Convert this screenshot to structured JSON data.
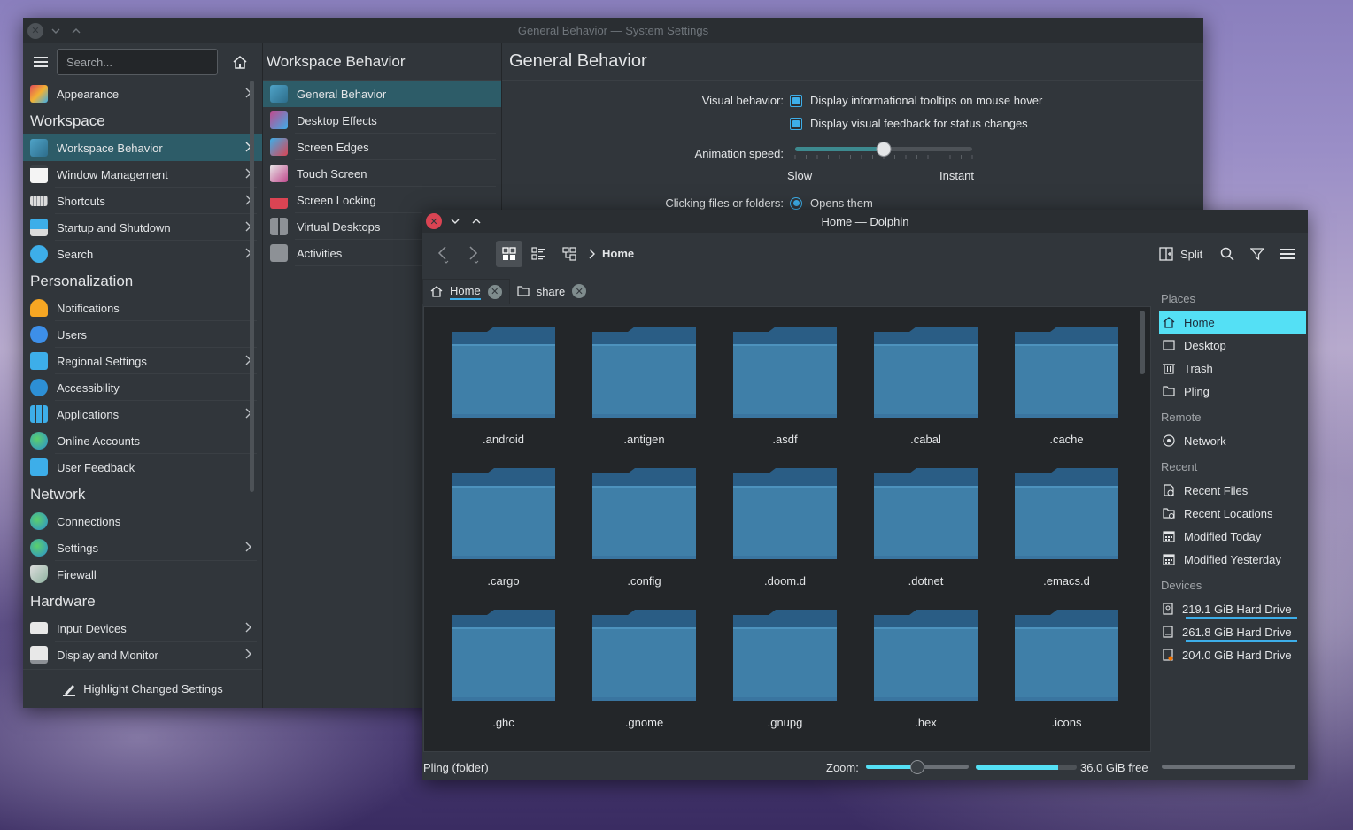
{
  "settings": {
    "window_title": "General Behavior — System Settings",
    "search_placeholder": "Search...",
    "sidebar": {
      "appearance": "Appearance",
      "cat_workspace": "Workspace",
      "workspace_behavior": "Workspace Behavior",
      "window_management": "Window Management",
      "shortcuts": "Shortcuts",
      "startup": "Startup and Shutdown",
      "search": "Search",
      "cat_personalization": "Personalization",
      "notifications": "Notifications",
      "users": "Users",
      "regional": "Regional Settings",
      "accessibility": "Accessibility",
      "applications": "Applications",
      "online_accounts": "Online Accounts",
      "user_feedback": "User Feedback",
      "cat_network": "Network",
      "connections": "Connections",
      "net_settings": "Settings",
      "firewall": "Firewall",
      "cat_hardware": "Hardware",
      "input_devices": "Input Devices",
      "display": "Display and Monitor"
    },
    "highlight_button": "Highlight Changed Settings",
    "middle": {
      "title": "Workspace Behavior",
      "items": [
        "General Behavior",
        "Desktop Effects",
        "Screen Edges",
        "Touch Screen",
        "Screen Locking",
        "Virtual Desktops",
        "Activities"
      ]
    },
    "page": {
      "title": "General Behavior",
      "visual_behavior_label": "Visual behavior:",
      "tooltips_label": "Display informational tooltips on mouse hover",
      "tooltips_checked": true,
      "feedback_label": "Display visual feedback for status changes",
      "feedback_checked": true,
      "animation_label": "Animation speed:",
      "animation_value": 0.5,
      "slow_label": "Slow",
      "instant_label": "Instant",
      "clicking_label": "Clicking files or folders:",
      "clicking_option": "Opens them"
    }
  },
  "dolphin": {
    "window_title": "Home — Dolphin",
    "breadcrumb": "Home",
    "split_label": "Split",
    "tabs": [
      {
        "label": "Home"
      },
      {
        "label": "share"
      }
    ],
    "files": [
      ".android",
      ".antigen",
      ".asdf",
      ".cabal",
      ".cache",
      ".cargo",
      ".config",
      ".doom.d",
      ".dotnet",
      ".emacs.d",
      ".ghc",
      ".gnome",
      ".gnupg",
      ".hex",
      ".icons"
    ],
    "places": {
      "cat_places": "Places",
      "home": "Home",
      "desktop": "Desktop",
      "trash": "Trash",
      "pling": "Pling",
      "cat_remote": "Remote",
      "network": "Network",
      "cat_recent": "Recent",
      "recent_files": "Recent Files",
      "recent_locations": "Recent Locations",
      "modified_today": "Modified Today",
      "modified_yesterday": "Modified Yesterday",
      "cat_devices": "Devices",
      "drive1": "219.1 GiB Hard Drive",
      "drive2": "261.8 GiB Hard Drive",
      "drive3": "204.0 GiB Hard Drive"
    },
    "status": {
      "selection": "Pling (folder)",
      "zoom_label": "Zoom:",
      "zoom_level": 0.5,
      "free_label": "36.0 GiB free",
      "disk_used_fraction": 0.82
    }
  },
  "colors": {
    "accent": "#3daee9",
    "selection": "#2d5c68",
    "places_highlight": "#54e0f5",
    "close_red": "#da4453",
    "folder": "#3f7fa8"
  }
}
